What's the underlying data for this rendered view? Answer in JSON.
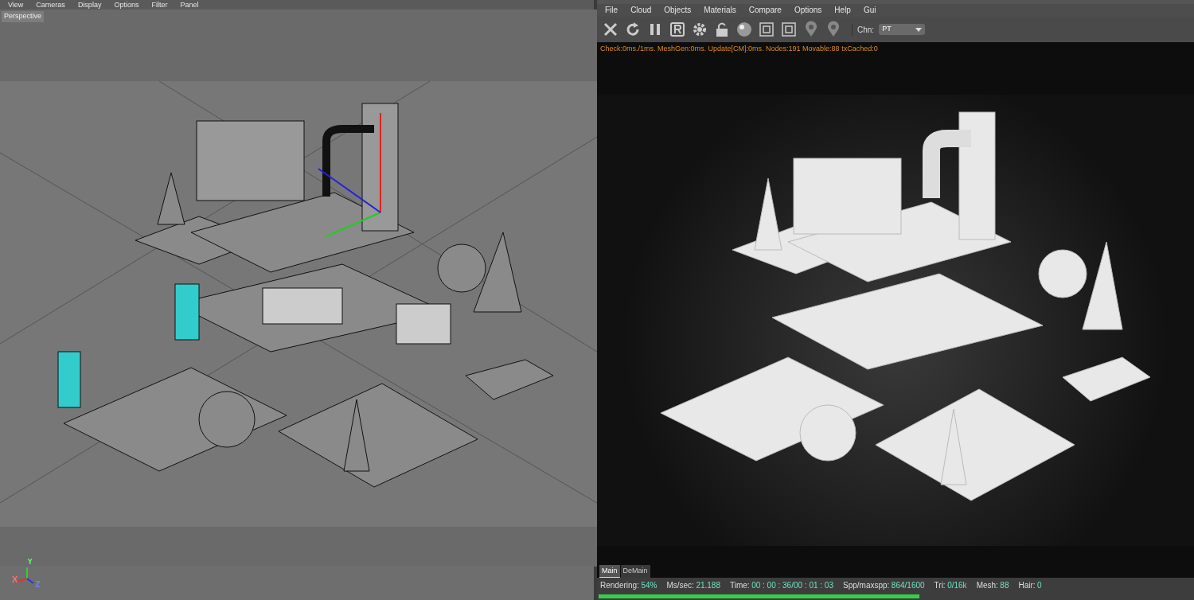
{
  "viewport": {
    "menu": [
      "View",
      "Cameras",
      "Display",
      "Options",
      "Filter",
      "Panel"
    ],
    "camera_label": "Perspective",
    "axis": [
      "X",
      "Y",
      "Z"
    ]
  },
  "live_viewer": {
    "menu": [
      "File",
      "Cloud",
      "Objects",
      "Materials",
      "Compare",
      "Options",
      "Help",
      "Gui"
    ],
    "channel_label": "Chn:",
    "channel_value": "PT",
    "stats_line": "Check:0ms./1ms. MeshGen:0ms. Update[CM]:0ms. Nodes:191 Movable:88 txCached:0",
    "tabs": [
      {
        "label": "Main",
        "selected": true
      },
      {
        "label": "DeMain",
        "selected": false
      }
    ],
    "status": [
      {
        "label": "Rendering:",
        "value": "54%"
      },
      {
        "label": "Ms/sec:",
        "value": "21.188"
      },
      {
        "label": "Time:",
        "value": "00 : 00 : 36/00 : 01 : 03"
      },
      {
        "label": "Spp/maxspp:",
        "value": "864/1600"
      },
      {
        "label": "Tri:",
        "value": "0/16k"
      },
      {
        "label": "Mesh:",
        "value": "88"
      },
      {
        "label": "Hair:",
        "value": "0"
      }
    ],
    "progress": {
      "level": 0.54
    }
  }
}
